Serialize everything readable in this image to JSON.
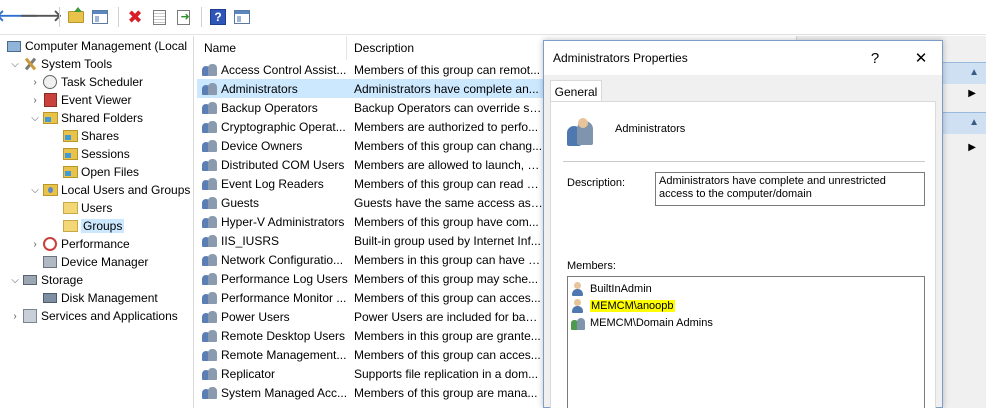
{
  "toolbar": {
    "back": "back-arrow-icon",
    "forward": "forward-arrow-icon",
    "help_glyph": "?"
  },
  "tree": {
    "root": "Computer Management (Local",
    "system_tools": "System Tools",
    "task_scheduler": "Task Scheduler",
    "event_viewer": "Event Viewer",
    "shared_folders": "Shared Folders",
    "shares": "Shares",
    "sessions": "Sessions",
    "open_files": "Open Files",
    "local_users": "Local Users and Groups",
    "users": "Users",
    "groups": "Groups",
    "performance": "Performance",
    "device_manager": "Device Manager",
    "storage": "Storage",
    "disk_management": "Disk Management",
    "services": "Services and Applications"
  },
  "list": {
    "col_name": "Name",
    "col_desc": "Description",
    "rows": [
      {
        "name": "Access Control Assist...",
        "desc": "Members of this group can remot..."
      },
      {
        "name": "Administrators",
        "desc": "Administrators have complete an..."
      },
      {
        "name": "Backup Operators",
        "desc": "Backup Operators can override se..."
      },
      {
        "name": "Cryptographic Operat...",
        "desc": "Members are authorized to perfo..."
      },
      {
        "name": "Device Owners",
        "desc": "Members of this group can chang..."
      },
      {
        "name": "Distributed COM Users",
        "desc": "Members are allowed to launch, a..."
      },
      {
        "name": "Event Log Readers",
        "desc": "Members of this group can read e..."
      },
      {
        "name": "Guests",
        "desc": "Guests have the same access as m..."
      },
      {
        "name": "Hyper-V Administrators",
        "desc": "Members of this group have com..."
      },
      {
        "name": "IIS_IUSRS",
        "desc": "Built-in group used by Internet Inf..."
      },
      {
        "name": "Network Configuratio...",
        "desc": "Members in this group can have s..."
      },
      {
        "name": "Performance Log Users",
        "desc": "Members of this group may sche..."
      },
      {
        "name": "Performance Monitor ...",
        "desc": "Members of this group can acces..."
      },
      {
        "name": "Power Users",
        "desc": "Power Users are included for back..."
      },
      {
        "name": "Remote Desktop Users",
        "desc": "Members in this group are grante..."
      },
      {
        "name": "Remote Management...",
        "desc": "Members of this group can acces..."
      },
      {
        "name": "Replicator",
        "desc": "Supports file replication in a dom..."
      },
      {
        "name": "System Managed Acc...",
        "desc": "Members of this group are mana..."
      }
    ]
  },
  "dialog": {
    "title": "Administrators Properties",
    "help_btn": "?",
    "close_btn": "✕",
    "tab_general": "General",
    "group_name": "Administrators",
    "description_label": "Description:",
    "description_value": "Administrators have complete and unrestricted access to the computer/domain",
    "members_label": "Members:",
    "members": [
      "BuiltInAdmin",
      "MEMCM\\anoopb",
      "MEMCM\\Domain Admins"
    ],
    "highlight_color": "#ffff00"
  }
}
